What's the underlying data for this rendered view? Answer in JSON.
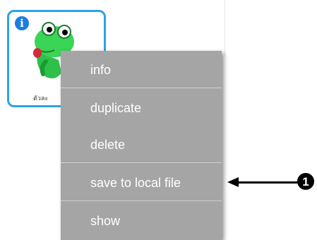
{
  "sprite": {
    "name": "ตัวละ",
    "info_icon_glyph": "i",
    "icon": "frog-sprite-icon",
    "border_color": "#2ba3e6"
  },
  "context_menu": {
    "items": [
      {
        "label": "info"
      },
      {
        "label": "duplicate"
      },
      {
        "label": "delete"
      },
      {
        "label": "save to local file"
      },
      {
        "label": "show"
      }
    ],
    "background_color": "#a5a5a5",
    "text_color": "#ffffff"
  },
  "annotation": {
    "callout_number": "1",
    "arrow_icon": "left-arrow-icon"
  }
}
